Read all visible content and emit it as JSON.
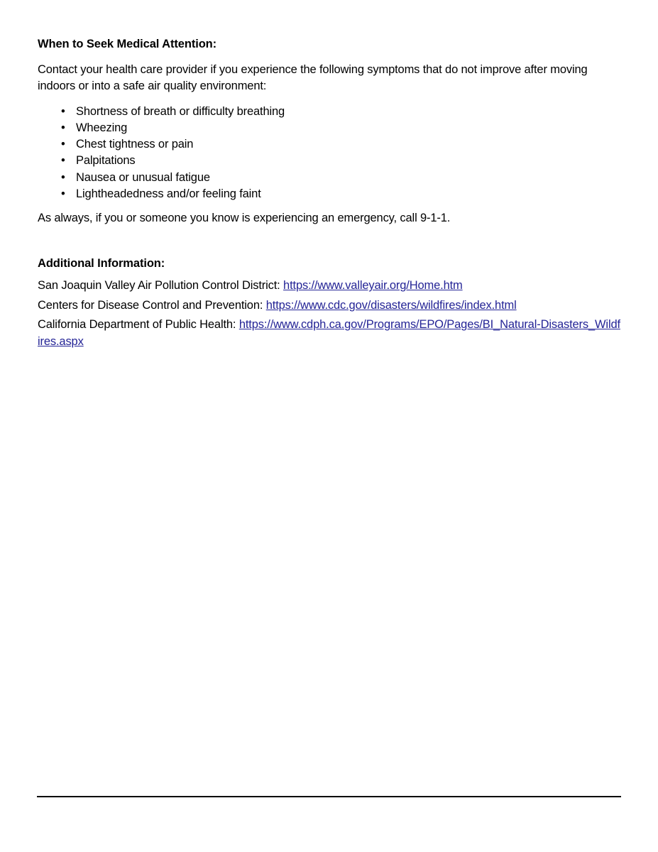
{
  "document": {
    "medical_attention": {
      "heading": "When to Seek Medical Attention:",
      "intro": "Contact your health care provider if you experience the following symptoms that do not improve after moving indoors or into a safe air quality environment:",
      "bullet_glyph": "•",
      "symptoms": [
        "Shortness of breath or difficulty breathing",
        "Wheezing",
        "Chest tightness or pain",
        "Palpitations",
        "Nausea or unusual fatigue",
        "Lightheadedness and/or feeling faint"
      ],
      "emergency_note": "As always, if you or someone you know is experiencing an emergency, call 9-1-1."
    },
    "additional_information": {
      "heading": "Additional Information:",
      "resources": [
        {
          "label": "San Joaquin Valley Air Pollution Control District: ",
          "url_text": "https://www.valleyair.org/Home.htm"
        },
        {
          "label": "Centers for Disease Control and Prevention: ",
          "url_text": "https://www.cdc.gov/disasters/wildfires/index.html"
        },
        {
          "label": "California Department of Public Health: ",
          "url_text": "https://www.cdph.ca.gov/Programs/EPO/Pages/BI_Natural-Disasters_Wildfires.aspx"
        }
      ]
    },
    "colors": {
      "link": "#242496",
      "text": "#000000",
      "background": "#ffffff",
      "rule": "#000000"
    }
  }
}
